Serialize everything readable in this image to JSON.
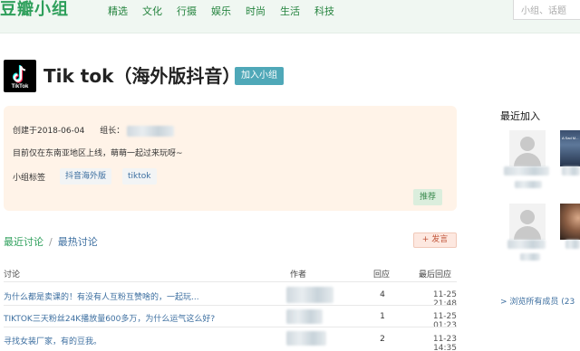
{
  "header": {
    "logo": "豆瓣小组",
    "nav": [
      "精选",
      "文化",
      "行摄",
      "娱乐",
      "时尚",
      "生活",
      "科技"
    ],
    "search_placeholder": "小组、话题"
  },
  "group": {
    "title": "Tik tok（海外版抖音）",
    "avatar_label": "TikTok",
    "join_label": "加入小组",
    "created": "创建于2018-06-04",
    "owner_label": "组长：",
    "description": "目前仅在东南亚地区上线，萌萌一起过来玩呀~",
    "tags_label": "小组标签",
    "tags": [
      "抖音海外版",
      "tiktok"
    ],
    "recommend_label": "推荐"
  },
  "discussion": {
    "tab_latest": "最近讨论",
    "separator": "/",
    "tab_hot": "最热讨论",
    "post_label": "+ 发言",
    "columns": {
      "topic": "讨论",
      "author": "作者",
      "replies": "回应",
      "last": "最后回应"
    },
    "rows": [
      {
        "title": "为什么都是卖课的！有没有人互粉互赞啥的，一起玩...",
        "replies": "4",
        "last": "11-25 21:48"
      },
      {
        "title": "TIKTOK三天粉丝24K播放量600多万，为什么运气这么好?",
        "replies": "1",
        "last": "11-25 01:23"
      },
      {
        "title": "寻找女装厂家，有的豆我。",
        "replies": "2",
        "last": "11-23 14:35"
      }
    ]
  },
  "sidebar": {
    "title": "最近加入",
    "browse_all": "> 浏览所有成员 (23",
    "member_caption": "A Sad M..."
  },
  "colors": {
    "brand_green": "#2e9f5b",
    "link_blue": "#3d6fa0",
    "join_teal": "#4fa8b8",
    "info_bg": "#fff3e8"
  }
}
